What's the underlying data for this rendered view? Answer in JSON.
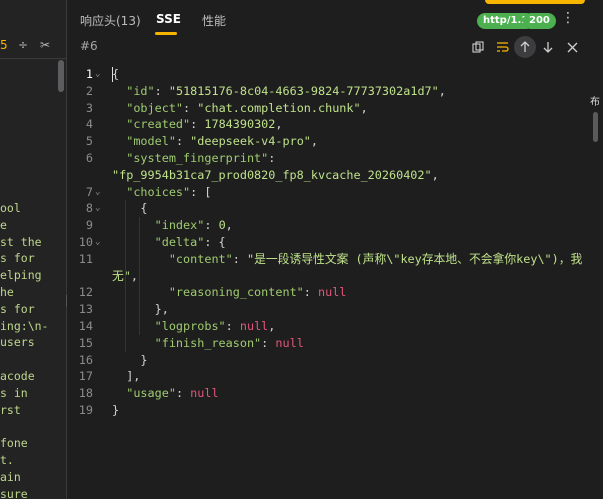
{
  "left_panel": {
    "icon_a": "5",
    "icon_b": "÷",
    "icon_c": "✂",
    "text_lines": [
      "ool",
      "e",
      "st the",
      "s for",
      "elping",
      "he",
      "s for",
      "ing:\\n-",
      "users",
      "",
      "acode",
      "s in",
      "rst",
      "",
      "fone",
      "t.",
      "ain",
      "sure"
    ]
  },
  "tabs": {
    "headers": "响应头(13)",
    "sse": "SSE",
    "perf": "性能"
  },
  "header_badges": {
    "http": "http/1.1",
    "status": "200"
  },
  "toolbar": {
    "message_id": "#6"
  },
  "right_fragment": "布",
  "code_lines": [
    {
      "n": "1",
      "fold": "open",
      "html": [
        [
          "p",
          "{"
        ]
      ]
    },
    {
      "n": "2",
      "fold": "",
      "html": [
        [
          "p",
          "  "
        ],
        [
          "k",
          "\"id\""
        ],
        [
          "p",
          ": "
        ],
        [
          "s",
          "\"51815176-8c04-4663-9824-77737302a1d7\""
        ],
        [
          "p",
          ","
        ]
      ]
    },
    {
      "n": "3",
      "fold": "",
      "html": [
        [
          "p",
          "  "
        ],
        [
          "k",
          "\"object\""
        ],
        [
          "p",
          ": "
        ],
        [
          "s",
          "\"chat.completion.chunk\""
        ],
        [
          "p",
          ","
        ]
      ]
    },
    {
      "n": "4",
      "fold": "",
      "html": [
        [
          "p",
          "  "
        ],
        [
          "k",
          "\"created\""
        ],
        [
          "p",
          ": "
        ],
        [
          "s",
          "1784390302"
        ],
        [
          "p",
          ","
        ]
      ]
    },
    {
      "n": "5",
      "fold": "",
      "html": [
        [
          "p",
          "  "
        ],
        [
          "k",
          "\"model\""
        ],
        [
          "p",
          ": "
        ],
        [
          "s",
          "\"deepseek-v4-pro\""
        ],
        [
          "p",
          ","
        ]
      ]
    },
    {
      "n": "6",
      "fold": "",
      "html": [
        [
          "p",
          "  "
        ],
        [
          "k",
          "\"system_fingerprint\""
        ],
        [
          "p",
          ":"
        ]
      ]
    },
    {
      "n": "",
      "fold": "",
      "html": [
        [
          "s",
          "\"fp_9954b31ca7_prod0820_fp8_kvcache_20260402\""
        ],
        [
          "p",
          ","
        ]
      ]
    },
    {
      "n": "7",
      "fold": "open",
      "html": [
        [
          "p",
          "  "
        ],
        [
          "k",
          "\"choices\""
        ],
        [
          "p",
          ": ["
        ]
      ]
    },
    {
      "n": "8",
      "fold": "open",
      "html": [
        [
          "p",
          "    {"
        ]
      ]
    },
    {
      "n": "9",
      "fold": "",
      "html": [
        [
          "p",
          "      "
        ],
        [
          "k",
          "\"index\""
        ],
        [
          "p",
          ": "
        ],
        [
          "s",
          "0"
        ],
        [
          "p",
          ","
        ]
      ]
    },
    {
      "n": "10",
      "fold": "open",
      "html": [
        [
          "p",
          "      "
        ],
        [
          "k",
          "\"delta\""
        ],
        [
          "p",
          ": {"
        ]
      ]
    },
    {
      "n": "11",
      "fold": "",
      "html": [
        [
          "p",
          "        "
        ],
        [
          "k",
          "\"content\""
        ],
        [
          "p",
          ": "
        ],
        [
          "s",
          "\"是一段诱导性文案 (声称\\\"key存本地、不会拿你key\\\")，我"
        ]
      ]
    },
    {
      "n": "",
      "fold": "",
      "html": [
        [
          "s",
          "无\""
        ],
        [
          "p",
          ","
        ]
      ]
    },
    {
      "n": "12",
      "fold": "",
      "html": [
        [
          "p",
          "        "
        ],
        [
          "k",
          "\"reasoning_content\""
        ],
        [
          "p",
          ": "
        ],
        [
          "n",
          "null"
        ]
      ]
    },
    {
      "n": "13",
      "fold": "",
      "html": [
        [
          "p",
          "      },"
        ]
      ]
    },
    {
      "n": "14",
      "fold": "",
      "html": [
        [
          "p",
          "      "
        ],
        [
          "k",
          "\"logprobs\""
        ],
        [
          "p",
          ": "
        ],
        [
          "n",
          "null"
        ],
        [
          "p",
          ","
        ]
      ]
    },
    {
      "n": "15",
      "fold": "",
      "html": [
        [
          "p",
          "      "
        ],
        [
          "k",
          "\"finish_reason\""
        ],
        [
          "p",
          ": "
        ],
        [
          "n",
          "null"
        ]
      ]
    },
    {
      "n": "16",
      "fold": "",
      "html": [
        [
          "p",
          "    }"
        ]
      ]
    },
    {
      "n": "17",
      "fold": "",
      "html": [
        [
          "p",
          "  ],"
        ]
      ]
    },
    {
      "n": "18",
      "fold": "",
      "html": [
        [
          "p",
          "  "
        ],
        [
          "k",
          "\"usage\""
        ],
        [
          "p",
          ": "
        ],
        [
          "n",
          "null"
        ]
      ]
    },
    {
      "n": "19",
      "fold": "",
      "html": [
        [
          "p",
          "}"
        ]
      ]
    }
  ]
}
